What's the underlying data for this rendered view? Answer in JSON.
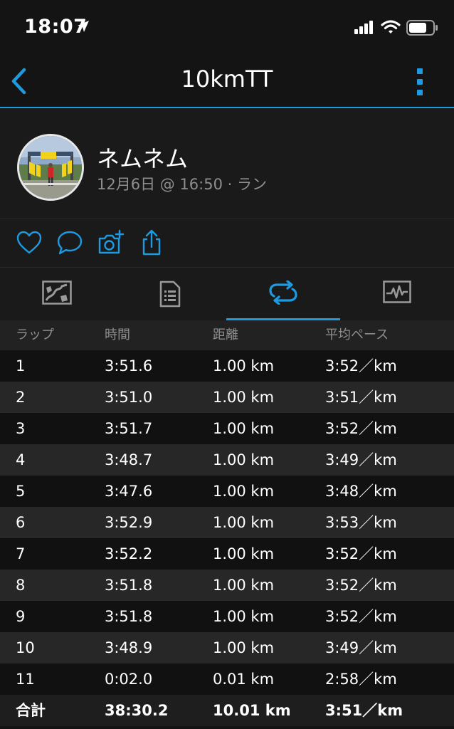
{
  "status_bar": {
    "time": "18:07"
  },
  "nav": {
    "title": "10kmTT"
  },
  "profile": {
    "name": "ネムネム",
    "meta": "12月6日 @ 16:50 · ラン"
  },
  "colors": {
    "accent": "#1e9be0",
    "background": "#141414"
  },
  "tabs": [
    {
      "icon": "map-icon",
      "active": false
    },
    {
      "icon": "details-icon",
      "active": false
    },
    {
      "icon": "laps-icon",
      "active": true
    },
    {
      "icon": "chart-icon",
      "active": false
    }
  ],
  "table": {
    "headers": [
      "ラップ",
      "時間",
      "距離",
      "平均ペース"
    ],
    "rows": [
      [
        "1",
        "3:51.6",
        "1.00 km",
        "3:52／km"
      ],
      [
        "2",
        "3:51.0",
        "1.00 km",
        "3:51／km"
      ],
      [
        "3",
        "3:51.7",
        "1.00 km",
        "3:52／km"
      ],
      [
        "4",
        "3:48.7",
        "1.00 km",
        "3:49／km"
      ],
      [
        "5",
        "3:47.6",
        "1.00 km",
        "3:48／km"
      ],
      [
        "6",
        "3:52.9",
        "1.00 km",
        "3:53／km"
      ],
      [
        "7",
        "3:52.2",
        "1.00 km",
        "3:52／km"
      ],
      [
        "8",
        "3:51.8",
        "1.00 km",
        "3:52／km"
      ],
      [
        "9",
        "3:51.8",
        "1.00 km",
        "3:52／km"
      ],
      [
        "10",
        "3:48.9",
        "1.00 km",
        "3:49／km"
      ],
      [
        "11",
        "0:02.0",
        "0.01 km",
        "2:58／km"
      ]
    ],
    "total": [
      "合計",
      "38:30.2",
      "10.01 km",
      "3:51／km"
    ]
  }
}
